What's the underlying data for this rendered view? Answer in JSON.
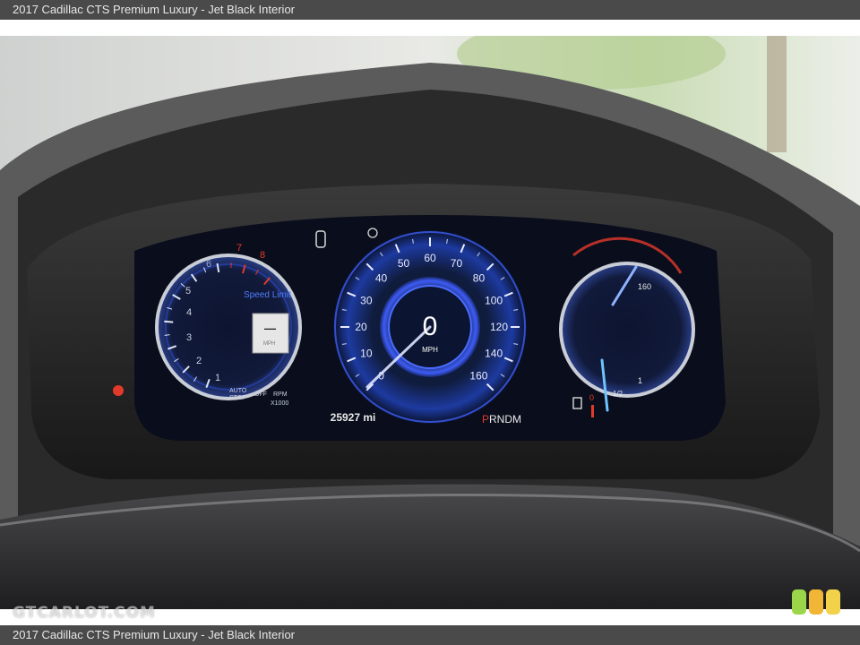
{
  "caption": {
    "top": "2017 Cadillac CTS Premium Luxury - Jet Black Interior",
    "bottom": "2017 Cadillac CTS Premium Luxury - Jet Black Interior"
  },
  "watermark": "GTCARLOT.COM",
  "cluster": {
    "speedometer": {
      "ticks": [
        "0",
        "10",
        "20",
        "30",
        "40",
        "50",
        "60",
        "70",
        "80",
        "100",
        "120",
        "140",
        "160"
      ],
      "current_speed": "0",
      "unit": "MPH"
    },
    "tachometer": {
      "ticks": [
        "1",
        "2",
        "3",
        "4",
        "5",
        "6",
        "7",
        "8"
      ],
      "auto_stop_line1": "AUTO",
      "auto_stop_line2": "STOP",
      "auto_stop_state": "OFF",
      "rpm_label_line1": "RPM",
      "rpm_label_line2": "X1000"
    },
    "speed_limit": {
      "title": "Speed Limit",
      "value": "—",
      "unit": "MPH"
    },
    "odometer": "25927 mi",
    "gear": {
      "active": "P",
      "rest": "RNDM"
    },
    "temp_gauge": {
      "value_label": "160"
    },
    "fuel_gauge": {
      "labels": [
        "1",
        "1/2",
        "0"
      ]
    }
  },
  "colors": {
    "caption_bar": "#4a4a4a",
    "gauge_blue": "#3b6cf0",
    "warning_red": "#e23a2a",
    "rating": [
      "#9bd64a",
      "#f2b636",
      "#f2d24b"
    ]
  }
}
